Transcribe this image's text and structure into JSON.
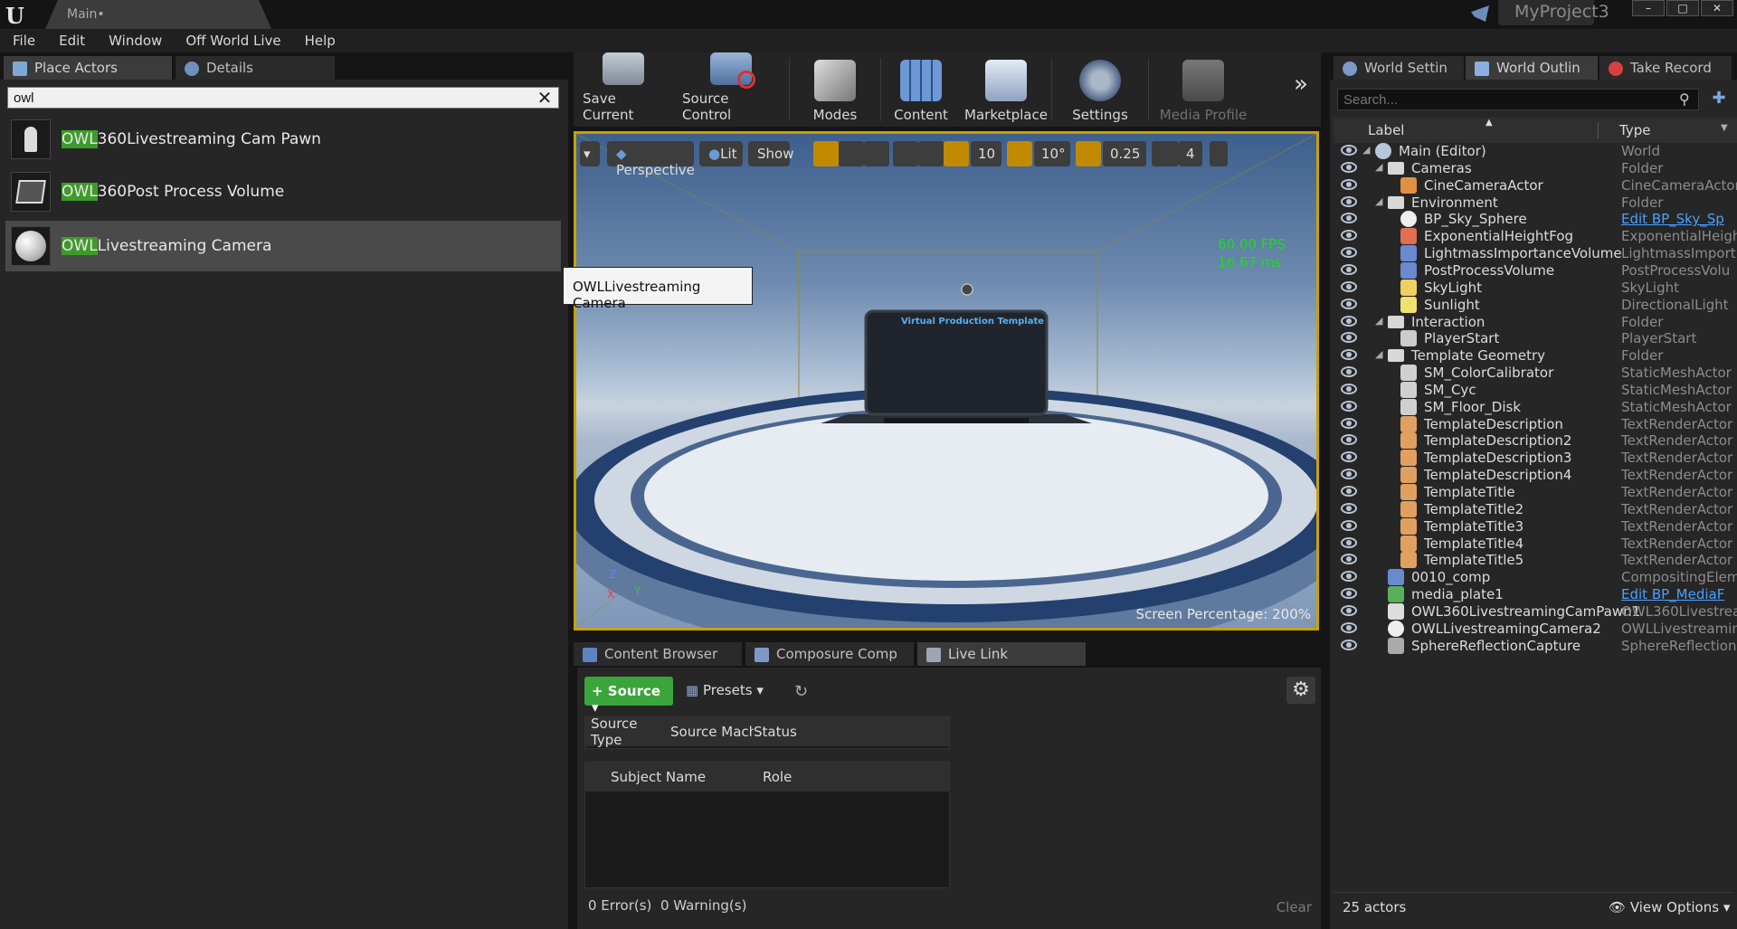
{
  "app": {
    "tab_title": "Main•",
    "project_name": "MyProject3",
    "window_buttons": [
      "–",
      "□",
      "✕"
    ]
  },
  "menu": [
    "File",
    "Edit",
    "Window",
    "Off World Live",
    "Help"
  ],
  "left_panel": {
    "tabs": [
      "Place Actors",
      "Details"
    ],
    "search_value": "owl",
    "clear_icon": "✕",
    "results": [
      {
        "highlight": "OWL",
        "rest": "360Livestreaming Cam Pawn",
        "icon": "pawn-icon"
      },
      {
        "highlight": "OWL",
        "rest": "360Post Process Volume",
        "icon": "postprocess-icon"
      },
      {
        "highlight": "OWL",
        "rest": "Livestreaming Camera",
        "icon": "sphere-icon",
        "selected": true
      }
    ],
    "tooltip": "OWLLivestreaming Camera"
  },
  "toolbar": {
    "buttons": [
      {
        "label": "Save Current",
        "icon": "save-icon",
        "color": "#9aa6b6"
      },
      {
        "label": "Source Control",
        "icon": "source-control-icon",
        "color": "#7a9cc6"
      },
      {
        "label": "Modes",
        "icon": "modes-icon",
        "color": "#9aa0a8"
      },
      {
        "label": "Content",
        "icon": "content-icon",
        "color": "#5b86c4"
      },
      {
        "label": "Marketplace",
        "icon": "marketplace-icon",
        "color": "#a8b6cc"
      },
      {
        "label": "Settings",
        "icon": "settings-icon",
        "color": "#8a9aae"
      },
      {
        "label": "Media Profile",
        "icon": "media-profile-icon",
        "color": "#6a6a6a"
      }
    ],
    "more": "»"
  },
  "viewport": {
    "perspective": "Perspective",
    "lit": "Lit",
    "show": "Show",
    "grid_snap": "10",
    "rotation_snap": "10°",
    "scale_snap": "0.25",
    "camera_speed": "4",
    "fps": "60.00 FPS",
    "ms": "16.67 ms",
    "screen_percentage_label": "Screen Percentage:",
    "screen_percentage_value": "200%",
    "screen_title": "Virtual Production Template",
    "axis_z": "Z",
    "axis_x": "X",
    "axis_y": "Y"
  },
  "bottom_panel": {
    "tabs": [
      "Content Browser",
      "Composure Comp",
      "Live Link"
    ],
    "source_button": "Source",
    "presets": "Presets",
    "source_table_headers": [
      "Source Type",
      "Source Machi",
      "Status"
    ],
    "subject_table_headers": [
      "Subject Name",
      "Role"
    ],
    "errors": "0 Error(s)",
    "warnings": "0 Warning(s)",
    "clear": "Clear"
  },
  "right_panel": {
    "tabs": [
      "World Settin",
      "World Outlin",
      "Take Record"
    ],
    "search_placeholder": "Search...",
    "col_label": "Label",
    "col_type": "Type",
    "rows": [
      {
        "label": "Main (Editor)",
        "type": "World",
        "indent": 0,
        "icon": "world-icon",
        "arrow": true
      },
      {
        "label": "Cameras",
        "type": "Folder",
        "indent": 1,
        "icon": "folder-icon",
        "arrow": true
      },
      {
        "label": "CineCameraActor",
        "type": "CineCameraActor",
        "indent": 2,
        "icon": "camera-icon"
      },
      {
        "label": "Environment",
        "type": "Folder",
        "indent": 1,
        "icon": "folder-icon",
        "arrow": true
      },
      {
        "label": "BP_Sky_Sphere",
        "type": "Edit BP_Sky_Sp",
        "indent": 2,
        "icon": "sphere-icon",
        "link": true
      },
      {
        "label": "ExponentialHeightFog",
        "type": "ExponentialHeigh",
        "indent": 2,
        "icon": "fog-icon"
      },
      {
        "label": "LightmassImportanceVolume",
        "type": "LightmassImport",
        "indent": 2,
        "icon": "volume-icon"
      },
      {
        "label": "PostProcessVolume",
        "type": "PostProcessVolu",
        "indent": 2,
        "icon": "volume-icon"
      },
      {
        "label": "SkyLight",
        "type": "SkyLight",
        "indent": 2,
        "icon": "light-icon"
      },
      {
        "label": "Sunlight",
        "type": "DirectionalLight",
        "indent": 2,
        "icon": "sun-icon"
      },
      {
        "label": "Interaction",
        "type": "Folder",
        "indent": 1,
        "icon": "folder-icon",
        "arrow": true
      },
      {
        "label": "PlayerStart",
        "type": "PlayerStart",
        "indent": 2,
        "icon": "player-start-icon"
      },
      {
        "label": "Template Geometry",
        "type": "Folder",
        "indent": 1,
        "icon": "folder-icon",
        "arrow": true
      },
      {
        "label": "SM_ColorCalibrator",
        "type": "StaticMeshActor",
        "indent": 2,
        "icon": "mesh-icon"
      },
      {
        "label": "SM_Cyc",
        "type": "StaticMeshActor",
        "indent": 2,
        "icon": "mesh-icon"
      },
      {
        "label": "SM_Floor_Disk",
        "type": "StaticMeshActor",
        "indent": 2,
        "icon": "mesh-icon"
      },
      {
        "label": "TemplateDescription",
        "type": "TextRenderActor",
        "indent": 2,
        "icon": "text-icon"
      },
      {
        "label": "TemplateDescription2",
        "type": "TextRenderActor",
        "indent": 2,
        "icon": "text-icon"
      },
      {
        "label": "TemplateDescription3",
        "type": "TextRenderActor",
        "indent": 2,
        "icon": "text-icon"
      },
      {
        "label": "TemplateDescription4",
        "type": "TextRenderActor",
        "indent": 2,
        "icon": "text-icon"
      },
      {
        "label": "TemplateTitle",
        "type": "TextRenderActor",
        "indent": 2,
        "icon": "text-icon"
      },
      {
        "label": "TemplateTitle2",
        "type": "TextRenderActor",
        "indent": 2,
        "icon": "text-icon"
      },
      {
        "label": "TemplateTitle3",
        "type": "TextRenderActor",
        "indent": 2,
        "icon": "text-icon"
      },
      {
        "label": "TemplateTitle4",
        "type": "TextRenderActor",
        "indent": 2,
        "icon": "text-icon"
      },
      {
        "label": "TemplateTitle5",
        "type": "TextRenderActor",
        "indent": 2,
        "icon": "text-icon"
      },
      {
        "label": "0010_comp",
        "type": "CompositingElem",
        "indent": 1,
        "icon": "compositing-icon"
      },
      {
        "label": "media_plate1",
        "type": "Edit BP_MediaF",
        "indent": 1,
        "icon": "media-plate-icon",
        "link": true
      },
      {
        "label": "OWL360LivestreamingCamPawn1",
        "type": "OWL360Livestrea",
        "indent": 1,
        "icon": "pawn-icon"
      },
      {
        "label": "OWLLivestreamingCamera2",
        "type": "OWLLivestreamin",
        "indent": 1,
        "icon": "sphere-icon"
      },
      {
        "label": "SphereReflectionCapture",
        "type": "SphereReflection",
        "indent": 1,
        "icon": "reflection-icon"
      }
    ],
    "actor_count": "25 actors",
    "view_options": "View Options"
  },
  "colors": {
    "accent_green": "#3f9a2a",
    "viewport_border": "#c9a200",
    "fps_green": "#18e018",
    "link_blue": "#4aa0ff"
  }
}
